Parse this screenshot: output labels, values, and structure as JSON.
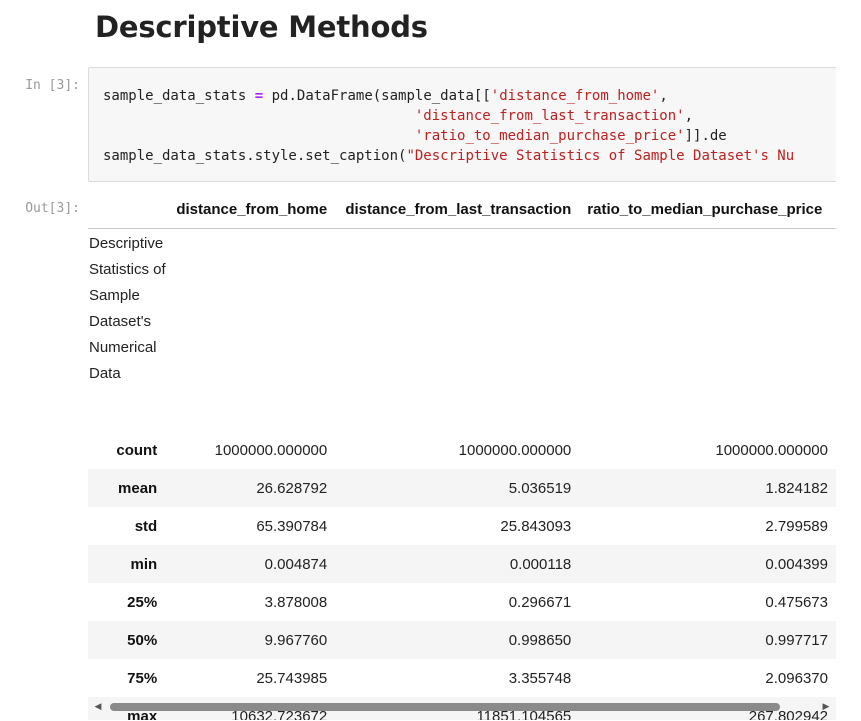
{
  "heading": "Descriptive Methods",
  "input_prompt": "In [3]:",
  "output_prompt": "Out[3]:",
  "code": {
    "l1_var": "sample_data_stats",
    "l1_eq": "=",
    "l1_call": "pd.DataFrame(sample_data[[",
    "l1_str": "'distance_from_home'",
    "l1_end": ",",
    "l2_pad": "                                     ",
    "l2_str": "'distance_from_last_transaction'",
    "l2_end": ",",
    "l3_pad": "                                     ",
    "l3_str": "'ratio_to_median_purchase_price'",
    "l3_end": "]].de",
    "l4_call": "sample_data_stats.style.set_caption(",
    "l4_str": "\"Descriptive Statistics of Sample Dataset's Nu"
  },
  "table": {
    "columns": [
      "distance_from_home",
      "distance_from_last_transaction",
      "ratio_to_median_purchase_price"
    ],
    "caption": "Descriptive Statistics of Sample Dataset's Numerical Data",
    "rows": [
      {
        "label": "count",
        "values": [
          "1000000.000000",
          "1000000.000000",
          "1000000.000000"
        ]
      },
      {
        "label": "mean",
        "values": [
          "26.628792",
          "5.036519",
          "1.824182"
        ]
      },
      {
        "label": "std",
        "values": [
          "65.390784",
          "25.843093",
          "2.799589"
        ]
      },
      {
        "label": "min",
        "values": [
          "0.004874",
          "0.000118",
          "0.004399"
        ]
      },
      {
        "label": "25%",
        "values": [
          "3.878008",
          "0.296671",
          "0.475673"
        ]
      },
      {
        "label": "50%",
        "values": [
          "9.967760",
          "0.998650",
          "0.997717"
        ]
      },
      {
        "label": "75%",
        "values": [
          "25.743985",
          "3.355748",
          "2.096370"
        ]
      },
      {
        "label": "max",
        "values": [
          "10632.723672",
          "11851.104565",
          "267.802942"
        ]
      }
    ]
  },
  "scrollbar": {
    "left_icon": "arrow-left-icon",
    "right_icon": "arrow-right-icon"
  }
}
